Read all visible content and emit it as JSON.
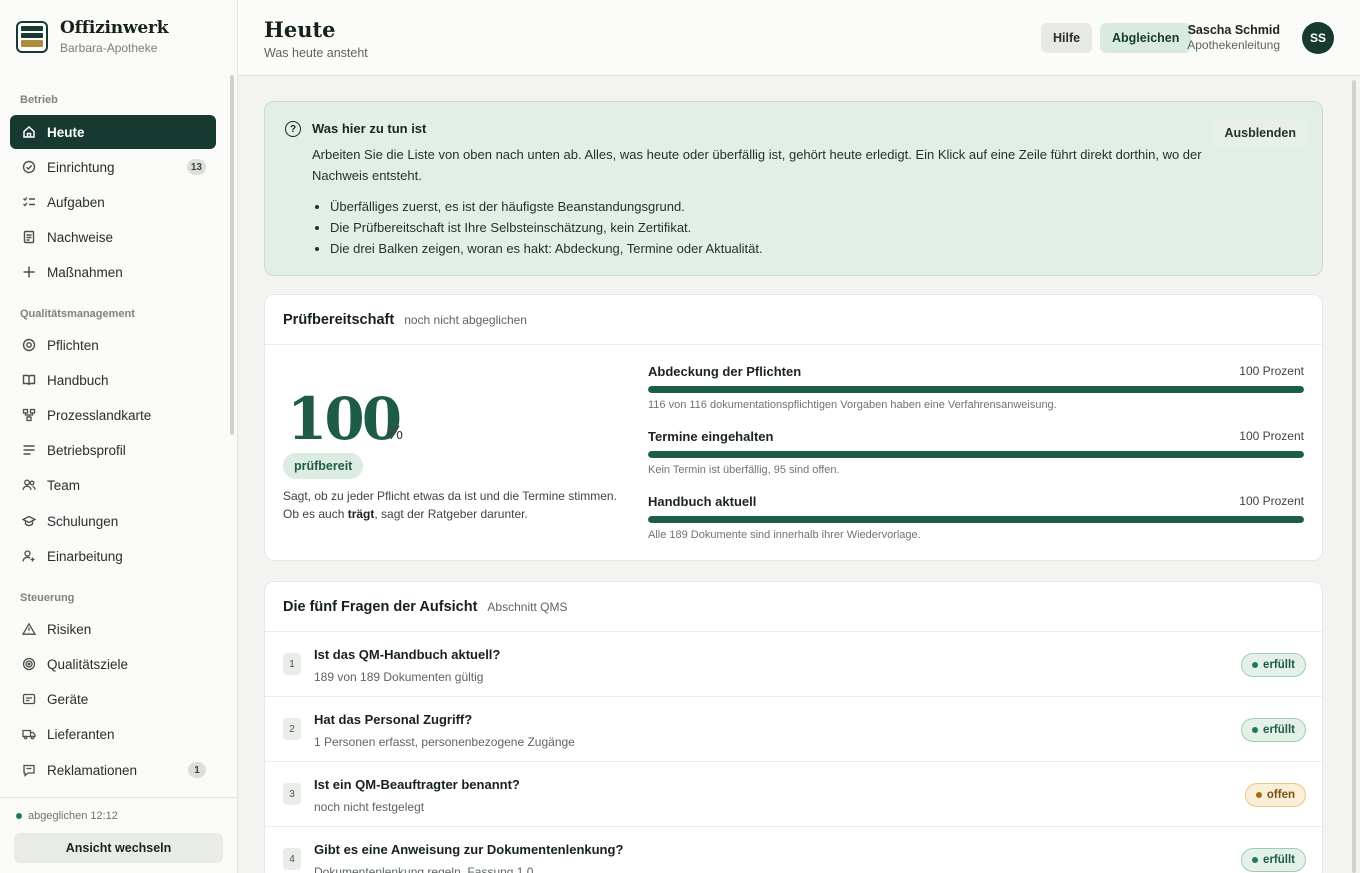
{
  "brand": {
    "name": "Offizinwerk",
    "pharmacy": "Barbara-Apotheke"
  },
  "sidebar": {
    "sections": [
      {
        "title": "Betrieb"
      },
      {
        "title": "Qualitätsmanagement"
      },
      {
        "title": "Steuerung"
      }
    ],
    "items": [
      {
        "label": "Heute",
        "icon": "home-icon",
        "active": true
      },
      {
        "label": "Einrichtung",
        "icon": "check-circle-icon",
        "count": "13"
      },
      {
        "label": "Aufgaben",
        "icon": "task-list-icon"
      },
      {
        "label": "Nachweise",
        "icon": "document-icon"
      },
      {
        "label": "Maßnahmen",
        "icon": "plus-icon"
      },
      {
        "label": "Pflichten",
        "icon": "target-icon"
      },
      {
        "label": "Handbuch",
        "icon": "book-icon"
      },
      {
        "label": "Prozesslandkarte",
        "icon": "process-map-icon"
      },
      {
        "label": "Betriebsprofil",
        "icon": "lines-icon"
      },
      {
        "label": "Team",
        "icon": "users-icon"
      },
      {
        "label": "Schulungen",
        "icon": "graduation-cap-icon"
      },
      {
        "label": "Einarbeitung",
        "icon": "user-add-icon"
      },
      {
        "label": "Risiken",
        "icon": "warning-triangle-icon"
      },
      {
        "label": "Qualitätsziele",
        "icon": "goal-icon"
      },
      {
        "label": "Geräte",
        "icon": "device-icon"
      },
      {
        "label": "Lieferanten",
        "icon": "truck-icon"
      },
      {
        "label": "Reklamationen",
        "icon": "comment-icon",
        "count": "1"
      }
    ],
    "footer": {
      "sync_status": "abgeglichen 12:12",
      "switch_label": "Ansicht wechseln"
    }
  },
  "header": {
    "title": "Heute",
    "subtitle": "Was heute ansteht",
    "help_label": "Hilfe",
    "sync_label": "Abgleichen",
    "user_name": "Sascha Schmid",
    "user_role": "Apothekenleitung",
    "user_initials": "SS"
  },
  "help_panel": {
    "title": "Was hier zu tun ist",
    "text": "Arbeiten Sie die Liste von oben nach unten ab. Alles, was heute oder überfällig ist, gehört heute erledigt. Ein Klick auf eine Zeile führt direkt dorthin, wo der Nachweis entsteht.",
    "bullets": [
      "Überfälliges zuerst, es ist der häufigste Beanstandungsgrund.",
      "Die Prüfbereitschaft ist Ihre Selbsteinschätzung, kein Zertifikat.",
      "Die drei Balken zeigen, woran es hakt: Abdeckung, Termine oder Aktualität."
    ],
    "hide_label": "Ausblenden"
  },
  "readiness": {
    "title": "Prüfbereitschaft",
    "subtitle": "noch nicht abgeglichen",
    "score": "100",
    "unit": "%",
    "badge": "prüfbereit",
    "desc_part1": "Sagt, ob zu jeder Pflicht etwas da ist und die Termine stimmen. Ob es auch ",
    "desc_bold": "trägt",
    "desc_part2": ", sagt der Ratgeber darunter.",
    "metrics": [
      {
        "label": "Abdeckung der Pflichten",
        "value": "100 Prozent",
        "fraction": 1.0,
        "note": "116 von 116 dokumentationspflichtigen Vorgaben haben eine Verfahrensanweisung."
      },
      {
        "label": "Termine eingehalten",
        "value": "100 Prozent",
        "fraction": 1.0,
        "note": "Kein Termin ist überfällig, 95 sind offen."
      },
      {
        "label": "Handbuch aktuell",
        "value": "100 Prozent",
        "fraction": 1.0,
        "note": "Alle 189 Dokumente sind innerhalb ihrer Wiedervorlage."
      }
    ]
  },
  "questions": {
    "title": "Die fünf Fragen der Aufsicht",
    "subtitle": "Abschnitt QMS",
    "rows": [
      {
        "num": "1",
        "text": "Ist das QM-Handbuch aktuell?",
        "detail": "189 von 189 Dokumenten gültig",
        "status": "erfüllt",
        "state": "ok"
      },
      {
        "num": "2",
        "text": "Hat das Personal Zugriff?",
        "detail": "1 Personen erfasst, personenbezogene Zugänge",
        "status": "erfüllt",
        "state": "ok"
      },
      {
        "num": "3",
        "text": "Ist ein QM-Beauftragter benannt?",
        "detail": "noch nicht festgelegt",
        "status": "offen",
        "state": "open"
      },
      {
        "num": "4",
        "text": "Gibt es eine Anweisung zur Dokumentenlenkung?",
        "detail": "Dokumentenlenkung regeln, Fassung 1.0",
        "status": "erfüllt",
        "state": "ok"
      }
    ]
  },
  "colors": {
    "accent": "#173a30",
    "progress": "#1d5e47",
    "ok": "#1f7a57",
    "open": "#a86b12"
  }
}
